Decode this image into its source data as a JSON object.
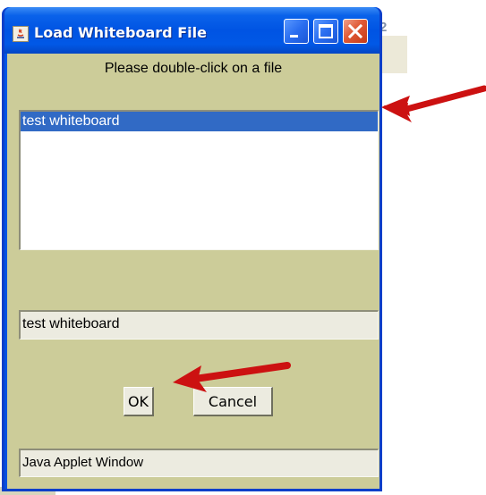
{
  "background": {
    "partial_text": "2"
  },
  "window": {
    "title": "Load Whiteboard File",
    "title_icon": "java-applet-icon",
    "controls": {
      "minimize_icon": "minimize-icon",
      "maximize_icon": "maximize-icon",
      "close_icon": "close-icon"
    }
  },
  "dialog": {
    "prompt": "Please double-click on a file",
    "files": [
      "test whiteboard"
    ],
    "selected_index": 0,
    "filename_value": "test whiteboard",
    "ok_label": "OK",
    "cancel_label": "Cancel",
    "status_text": "Java Applet Window"
  },
  "annotations": {
    "arrow_color": "#cc1111",
    "arrows": [
      "arrow-pointing-to-selected-file",
      "arrow-pointing-to-ok-button"
    ]
  },
  "colors": {
    "title_bar": "#0054e3",
    "client_bg": "#cccc99",
    "selection": "#316ac5",
    "close_button": "#e05a36"
  }
}
